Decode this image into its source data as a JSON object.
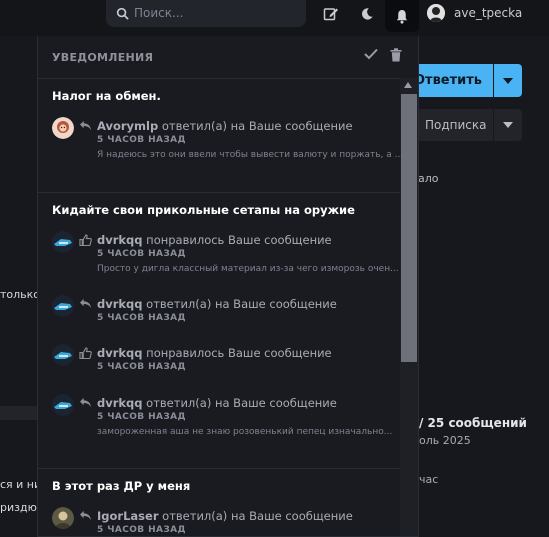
{
  "topbar": {
    "search_placeholder": "Поиск...",
    "username": "ave_tpecka"
  },
  "background": {
    "reply_button": "Ответить",
    "subscribe_button": "Подписка",
    "text_nachalo": "ало",
    "text_tolko": "только",
    "text_ni": "ся и ни",
    "text_izdok": "риздюк",
    "text_messages": "/ 25 сообщений",
    "text_year": "оль 2025",
    "text_now": "час"
  },
  "panel": {
    "title": "УВЕДОМЛЕНИЯ",
    "groups": [
      {
        "title": "Налог на обмен.",
        "items": [
          {
            "user": "Avorymlp",
            "action": "ответил(а) на Ваше сообщение",
            "time": "5 ЧАСОВ НАЗАД",
            "snippet": "Я надеюсь это они ввели чтобы вывести валюту и поржать, а ..."
          }
        ]
      },
      {
        "title": "Кидайте свои прикольные сетапы на оружие",
        "items": [
          {
            "user": "dvrkqq",
            "action": "понравилось Ваше сообщение",
            "time": "5 ЧАСОВ НАЗАД",
            "snippet": "Просто у дигла классный материал из-за чего изморозь очен..."
          },
          {
            "user": "dvrkqq",
            "action": "ответил(а) на Ваше сообщение",
            "time": "5 ЧАСОВ НАЗАД",
            "snippet": ""
          },
          {
            "user": "dvrkqq",
            "action": "понравилось Ваше сообщение",
            "time": "5 ЧАСОВ НАЗАД",
            "snippet": ""
          },
          {
            "user": "dvrkqq",
            "action": "ответил(а) на Ваше сообщение",
            "time": "5 ЧАСОВ НАЗАД",
            "snippet": "замороженная аша не знаю розовенький пепец изначально..."
          }
        ]
      },
      {
        "title": "В этот раз ДР у меня",
        "items": [
          {
            "user": "IgorLaser",
            "action": "ответил(а) на Ваше сообщение",
            "time": "5 ЧАСОВ НАЗАД",
            "snippet": ""
          }
        ]
      }
    ]
  }
}
